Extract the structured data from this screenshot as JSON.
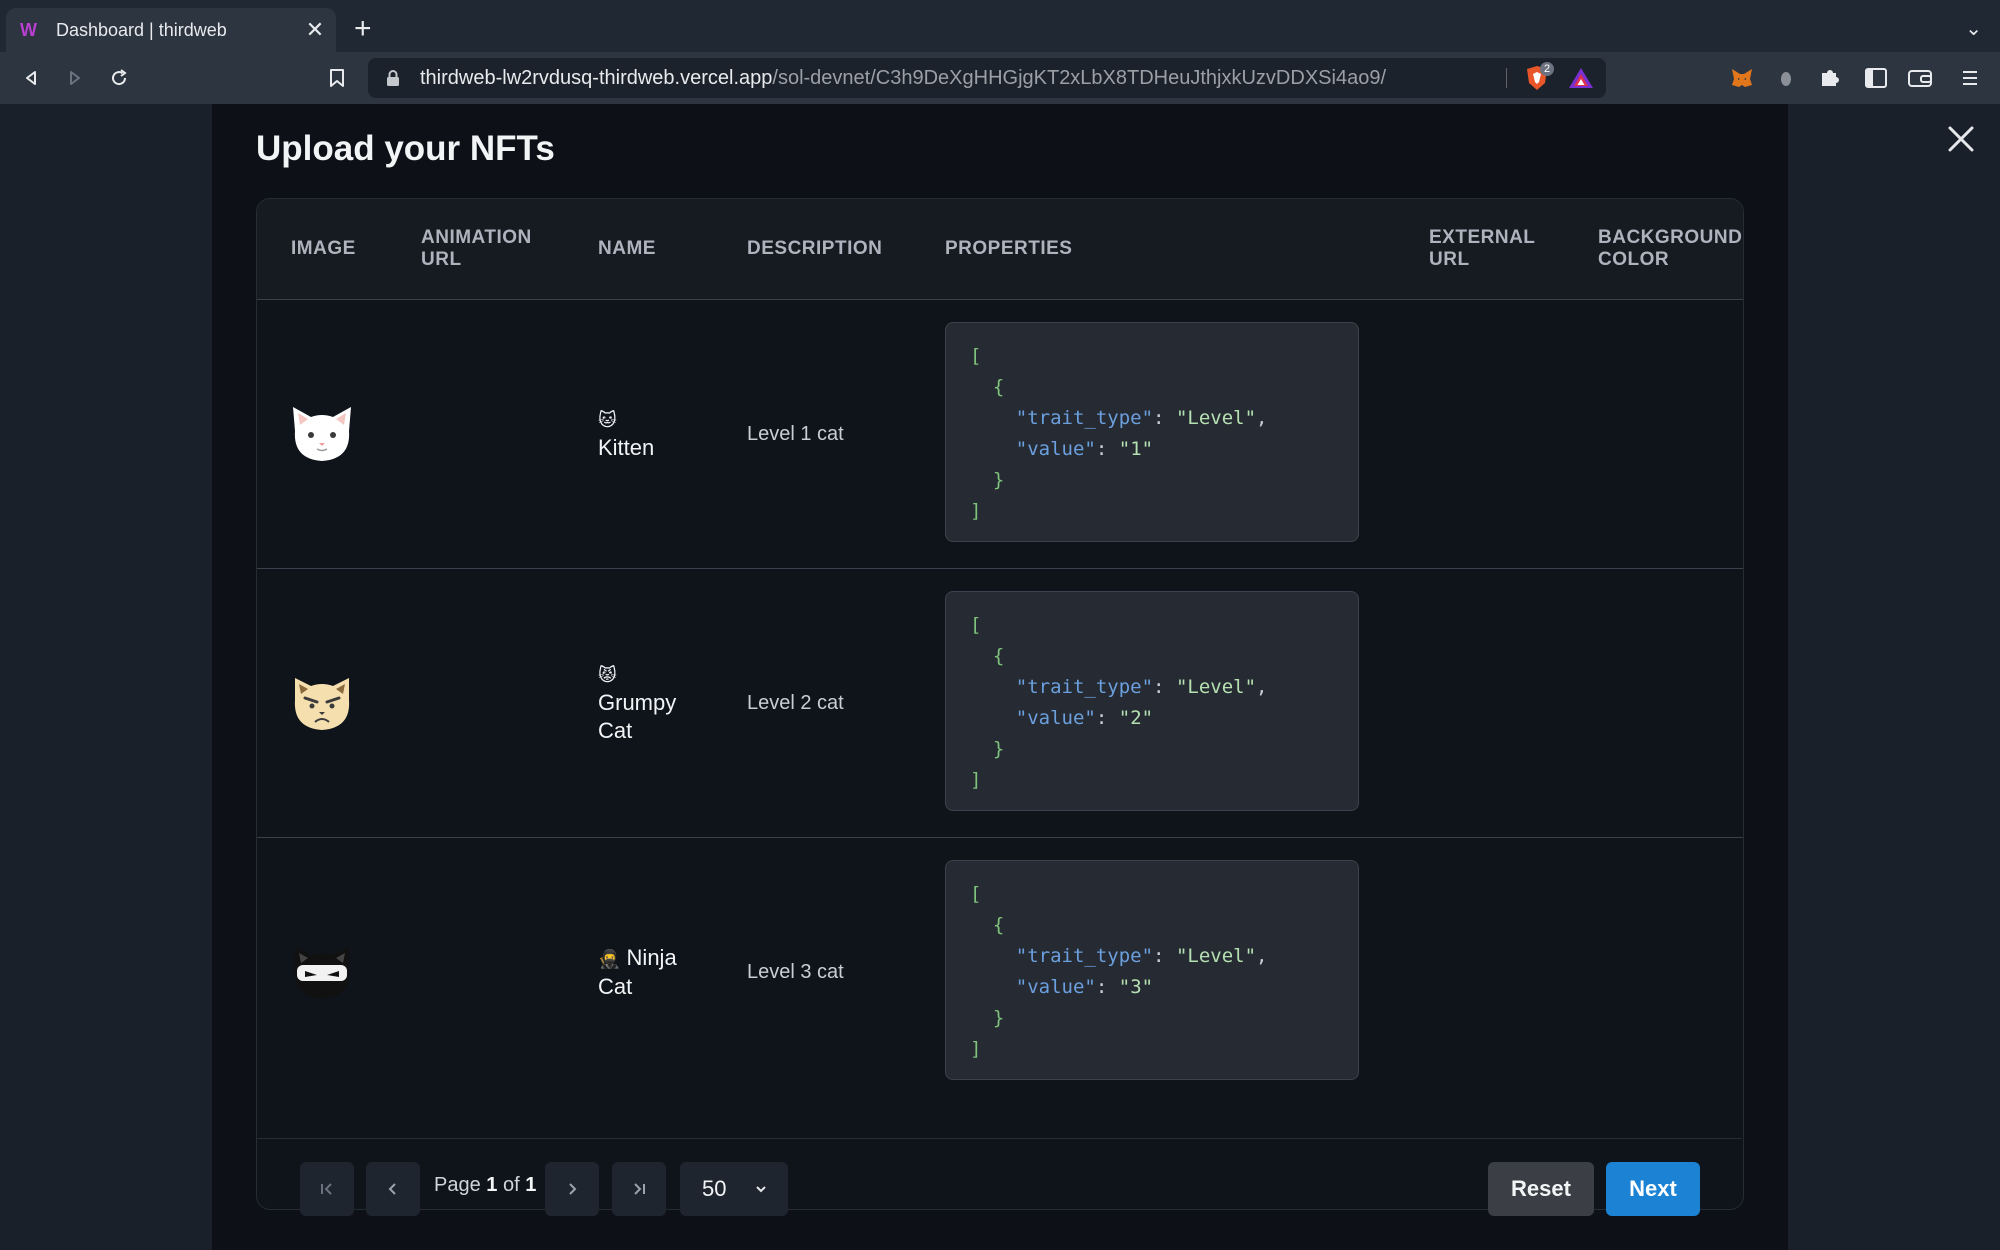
{
  "browser": {
    "tab_title": "Dashboard | thirdweb",
    "url_host": "thirdweb-lw2rvdusq-thirdweb.vercel.app",
    "url_path": "/sol-devnet/C3h9DeXgHHGjgKT2xLbX8TDHeuJthjxkUzvDDXSi4ao9/",
    "shield_count": "2"
  },
  "modal": {
    "title": "Upload your NFTs"
  },
  "table": {
    "columns": [
      "IMAGE",
      "ANIMATION URL",
      "NAME",
      "DESCRIPTION",
      "PROPERTIES",
      "EXTERNAL URL",
      "BACKGROUND COLOR"
    ],
    "rows": [
      {
        "image": "white-kitten-face",
        "emoji": "🐱",
        "name": "Kitten",
        "description": "Level 1 cat",
        "properties": {
          "trait_type": "Level",
          "value": "1"
        }
      },
      {
        "image": "grumpy-cat-face",
        "emoji": "😾",
        "name": "Grumpy Cat",
        "description": "Level 2 cat",
        "properties": {
          "trait_type": "Level",
          "value": "2"
        }
      },
      {
        "image": "ninja-cat-face",
        "emoji": "🥷",
        "name": "Ninja Cat",
        "description": "Level 3 cat",
        "properties": {
          "trait_type": "Level",
          "value": "3"
        }
      }
    ]
  },
  "pagination": {
    "page_word": "Page",
    "current_page": "1",
    "of_word": "of",
    "total_pages": "1",
    "page_size": "50"
  },
  "actions": {
    "reset_label": "Reset",
    "next_label": "Next"
  },
  "colors": {
    "modal_bg": "#0d1117",
    "next_button": "#1b82d4",
    "reset_button": "#3b3f45",
    "json_key": "#6b9fdd",
    "json_punctuation": "#7ec27b"
  }
}
